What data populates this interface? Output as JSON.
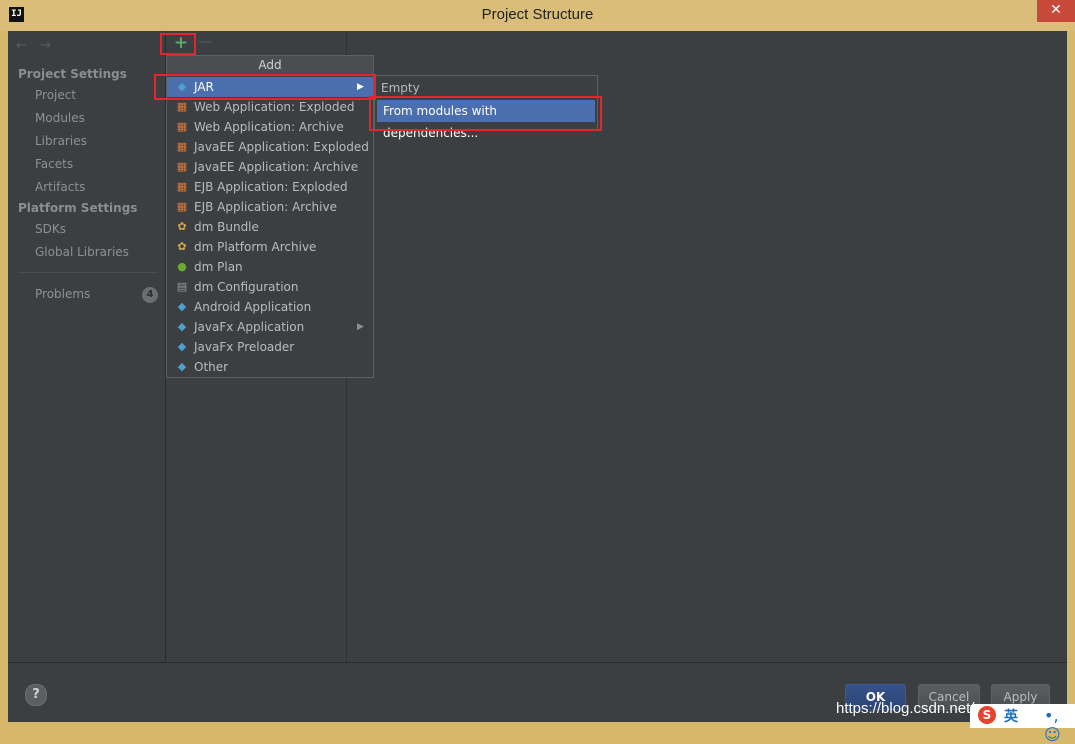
{
  "window": {
    "title": "Project Structure",
    "app_icon": "IJ",
    "close_glyph": "✕"
  },
  "nav": {
    "back_icon": "←",
    "forward_icon": "→"
  },
  "sidebar": {
    "project_settings": "Project Settings",
    "project_items": [
      "Project",
      "Modules",
      "Libraries",
      "Facets",
      "Artifacts"
    ],
    "platform_settings": "Platform Settings",
    "platform_items": [
      "SDKs",
      "Global Libraries"
    ],
    "problems": {
      "label": "Problems",
      "count": "4"
    }
  },
  "toolbar": {
    "add_glyph": "+",
    "remove_glyph": "—"
  },
  "add_menu": {
    "title": "Add",
    "items": [
      {
        "label": "JAR",
        "icon": "diamond-icon",
        "has_submenu": true
      },
      {
        "label": "Web Application: Exploded",
        "icon": "box-icon"
      },
      {
        "label": "Web Application: Archive",
        "icon": "box-icon"
      },
      {
        "label": "JavaEE Application: Exploded",
        "icon": "box-icon"
      },
      {
        "label": "JavaEE Application: Archive",
        "icon": "box-icon"
      },
      {
        "label": "EJB Application: Exploded",
        "icon": "box-icon"
      },
      {
        "label": "EJB Application: Archive",
        "icon": "box-icon"
      },
      {
        "label": "dm Bundle",
        "icon": "gear-icon"
      },
      {
        "label": "dm Platform Archive",
        "icon": "gear-icon"
      },
      {
        "label": "dm Plan",
        "icon": "globe-icon"
      },
      {
        "label": "dm Configuration",
        "icon": "document-icon"
      },
      {
        "label": "Android Application",
        "icon": "diamond-icon"
      },
      {
        "label": "JavaFx Application",
        "icon": "diamond-icon",
        "has_submenu": true
      },
      {
        "label": "JavaFx Preloader",
        "icon": "diamond-icon"
      },
      {
        "label": "Other",
        "icon": "diamond-icon"
      }
    ]
  },
  "jar_submenu": {
    "items": [
      "Empty",
      "From modules with dependencies..."
    ]
  },
  "buttons": {
    "help": "?",
    "ok": "OK",
    "cancel": "Cancel",
    "apply": "Apply"
  },
  "watermark": "https://blog.csdn.net/...",
  "ime": {
    "logo": "S",
    "lang": "英",
    "extra": "•, ☺"
  },
  "colors": {
    "selection": "#4b6eaf",
    "highlight_box": "#e3262c",
    "background": "#3c3f41"
  }
}
